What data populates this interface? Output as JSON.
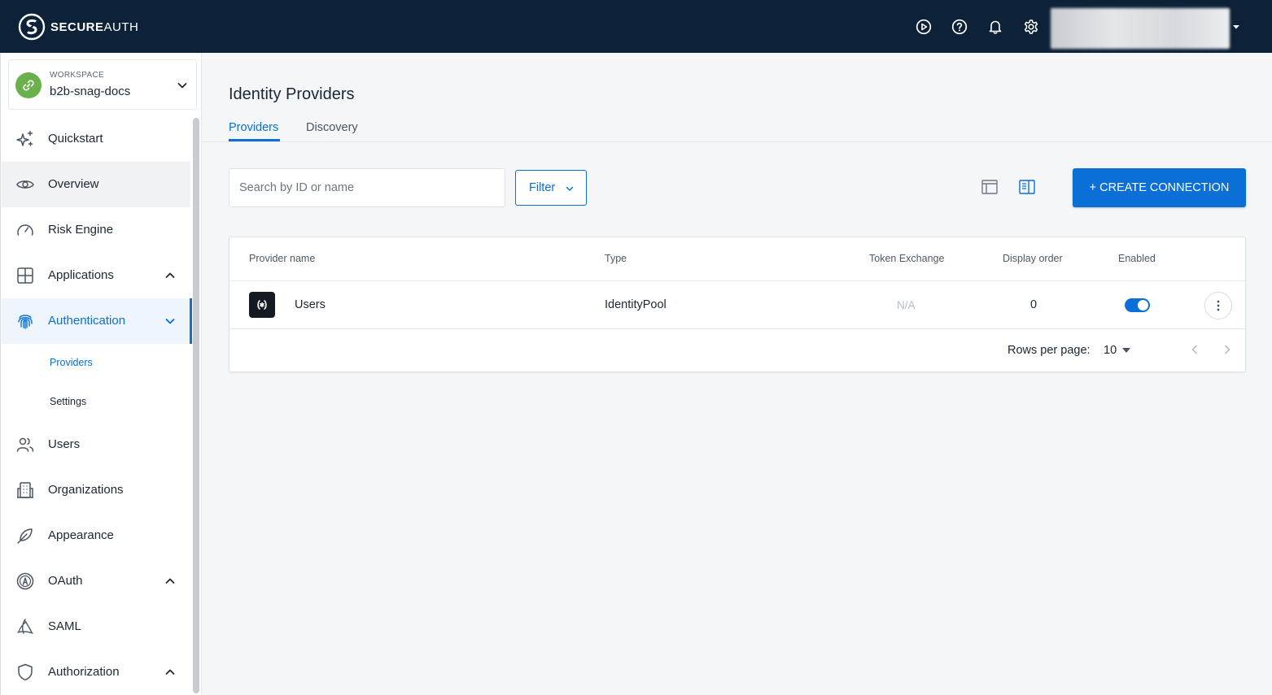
{
  "brand": {
    "bold": "SECURE",
    "light": "AUTH"
  },
  "header": {
    "icons": [
      "play-circle-icon",
      "help-circle-icon",
      "bell-icon",
      "gear-icon"
    ]
  },
  "workspace": {
    "label": "WORKSPACE",
    "name": "b2b-snag-docs"
  },
  "sidebar": {
    "items": [
      {
        "label": "Quickstart",
        "icon": "sparkles-icon"
      },
      {
        "label": "Overview",
        "icon": "eye-icon"
      },
      {
        "label": "Risk Engine",
        "icon": "gauge-icon"
      },
      {
        "label": "Applications",
        "icon": "grid-icon"
      },
      {
        "label": "Authentication",
        "icon": "fingerprint-icon"
      },
      {
        "label": "Users",
        "icon": "users-icon"
      },
      {
        "label": "Organizations",
        "icon": "building-icon"
      },
      {
        "label": "Appearance",
        "icon": "feather-icon"
      },
      {
        "label": "OAuth",
        "icon": "oauth-icon"
      },
      {
        "label": "SAML",
        "icon": "saml-icon"
      },
      {
        "label": "Authorization",
        "icon": "shield-icon"
      }
    ],
    "sub_items": [
      {
        "label": "Providers"
      },
      {
        "label": "Settings"
      }
    ]
  },
  "page": {
    "title": "Identity Providers",
    "tabs": [
      {
        "label": "Providers"
      },
      {
        "label": "Discovery"
      }
    ]
  },
  "toolbar": {
    "search_placeholder": "Search by ID or name",
    "filter_label": "Filter",
    "create_label": "+ CREATE CONNECTION"
  },
  "table": {
    "columns": [
      "Provider name",
      "Type",
      "Token Exchange",
      "Display order",
      "Enabled"
    ],
    "rows": [
      {
        "name": "Users",
        "type": "IdentityPool",
        "token_exchange": "N/A",
        "display_order": "0",
        "enabled": true
      }
    ],
    "rows_per_page_label": "Rows per page:",
    "rows_per_page": "10"
  },
  "colors": {
    "accent": "#0a6fd6",
    "header_bg": "#0d2238",
    "workspace_avatar": "#6ab04c"
  }
}
